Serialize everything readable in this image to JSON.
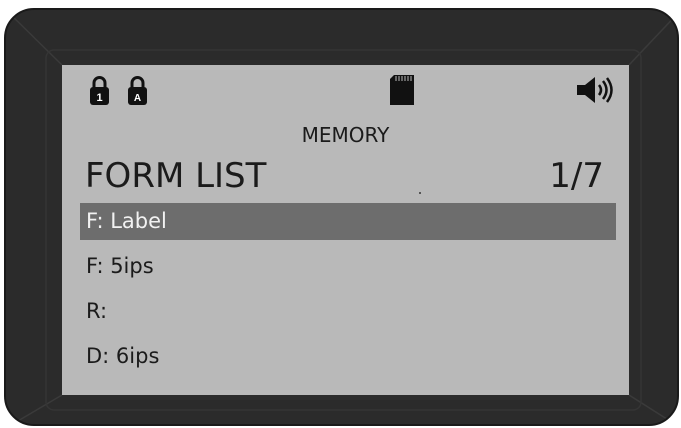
{
  "status_bar": {
    "lock_1_badge": "1",
    "lock_a_badge": "A",
    "icons": [
      "lock-1-icon",
      "lock-a-icon",
      "sd-card-icon",
      "speaker-icon"
    ]
  },
  "menu": {
    "title": "MEMORY",
    "heading": "FORM LIST",
    "page": "1/7"
  },
  "items": [
    {
      "label": "F: Label",
      "selected": true
    },
    {
      "label": "F: 5ips",
      "selected": false
    },
    {
      "label": "R:",
      "selected": false
    },
    {
      "label": "D: 6ips",
      "selected": false
    }
  ],
  "colors": {
    "screen": "#b9b9b9",
    "bezel": "#2b2b2b",
    "highlight": "#6d6d6d",
    "text": "#1b1b1b"
  }
}
